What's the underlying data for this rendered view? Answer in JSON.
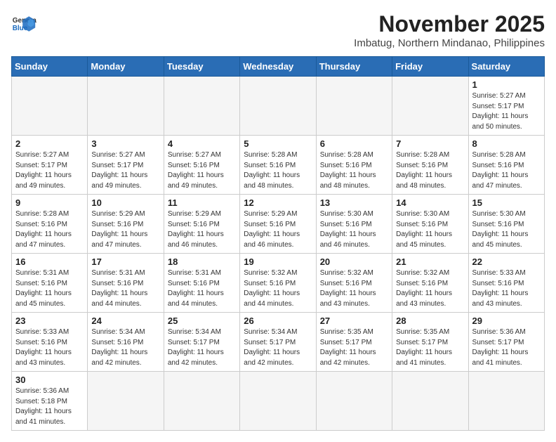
{
  "header": {
    "logo_general": "General",
    "logo_blue": "Blue",
    "month_year": "November 2025",
    "location": "Imbatug, Northern Mindanao, Philippines"
  },
  "days_of_week": [
    "Sunday",
    "Monday",
    "Tuesday",
    "Wednesday",
    "Thursday",
    "Friday",
    "Saturday"
  ],
  "weeks": [
    [
      {
        "day": "",
        "empty": true
      },
      {
        "day": "",
        "empty": true
      },
      {
        "day": "",
        "empty": true
      },
      {
        "day": "",
        "empty": true
      },
      {
        "day": "",
        "empty": true
      },
      {
        "day": "",
        "empty": true
      },
      {
        "day": "1",
        "sunrise": "Sunrise: 5:27 AM",
        "sunset": "Sunset: 5:17 PM",
        "daylight": "Daylight: 11 hours and 50 minutes."
      }
    ],
    [
      {
        "day": "2",
        "sunrise": "Sunrise: 5:27 AM",
        "sunset": "Sunset: 5:17 PM",
        "daylight": "Daylight: 11 hours and 49 minutes."
      },
      {
        "day": "3",
        "sunrise": "Sunrise: 5:27 AM",
        "sunset": "Sunset: 5:17 PM",
        "daylight": "Daylight: 11 hours and 49 minutes."
      },
      {
        "day": "4",
        "sunrise": "Sunrise: 5:27 AM",
        "sunset": "Sunset: 5:16 PM",
        "daylight": "Daylight: 11 hours and 49 minutes."
      },
      {
        "day": "5",
        "sunrise": "Sunrise: 5:28 AM",
        "sunset": "Sunset: 5:16 PM",
        "daylight": "Daylight: 11 hours and 48 minutes."
      },
      {
        "day": "6",
        "sunrise": "Sunrise: 5:28 AM",
        "sunset": "Sunset: 5:16 PM",
        "daylight": "Daylight: 11 hours and 48 minutes."
      },
      {
        "day": "7",
        "sunrise": "Sunrise: 5:28 AM",
        "sunset": "Sunset: 5:16 PM",
        "daylight": "Daylight: 11 hours and 48 minutes."
      },
      {
        "day": "8",
        "sunrise": "Sunrise: 5:28 AM",
        "sunset": "Sunset: 5:16 PM",
        "daylight": "Daylight: 11 hours and 47 minutes."
      }
    ],
    [
      {
        "day": "9",
        "sunrise": "Sunrise: 5:28 AM",
        "sunset": "Sunset: 5:16 PM",
        "daylight": "Daylight: 11 hours and 47 minutes."
      },
      {
        "day": "10",
        "sunrise": "Sunrise: 5:29 AM",
        "sunset": "Sunset: 5:16 PM",
        "daylight": "Daylight: 11 hours and 47 minutes."
      },
      {
        "day": "11",
        "sunrise": "Sunrise: 5:29 AM",
        "sunset": "Sunset: 5:16 PM",
        "daylight": "Daylight: 11 hours and 46 minutes."
      },
      {
        "day": "12",
        "sunrise": "Sunrise: 5:29 AM",
        "sunset": "Sunset: 5:16 PM",
        "daylight": "Daylight: 11 hours and 46 minutes."
      },
      {
        "day": "13",
        "sunrise": "Sunrise: 5:30 AM",
        "sunset": "Sunset: 5:16 PM",
        "daylight": "Daylight: 11 hours and 46 minutes."
      },
      {
        "day": "14",
        "sunrise": "Sunrise: 5:30 AM",
        "sunset": "Sunset: 5:16 PM",
        "daylight": "Daylight: 11 hours and 45 minutes."
      },
      {
        "day": "15",
        "sunrise": "Sunrise: 5:30 AM",
        "sunset": "Sunset: 5:16 PM",
        "daylight": "Daylight: 11 hours and 45 minutes."
      }
    ],
    [
      {
        "day": "16",
        "sunrise": "Sunrise: 5:31 AM",
        "sunset": "Sunset: 5:16 PM",
        "daylight": "Daylight: 11 hours and 45 minutes."
      },
      {
        "day": "17",
        "sunrise": "Sunrise: 5:31 AM",
        "sunset": "Sunset: 5:16 PM",
        "daylight": "Daylight: 11 hours and 44 minutes."
      },
      {
        "day": "18",
        "sunrise": "Sunrise: 5:31 AM",
        "sunset": "Sunset: 5:16 PM",
        "daylight": "Daylight: 11 hours and 44 minutes."
      },
      {
        "day": "19",
        "sunrise": "Sunrise: 5:32 AM",
        "sunset": "Sunset: 5:16 PM",
        "daylight": "Daylight: 11 hours and 44 minutes."
      },
      {
        "day": "20",
        "sunrise": "Sunrise: 5:32 AM",
        "sunset": "Sunset: 5:16 PM",
        "daylight": "Daylight: 11 hours and 43 minutes."
      },
      {
        "day": "21",
        "sunrise": "Sunrise: 5:32 AM",
        "sunset": "Sunset: 5:16 PM",
        "daylight": "Daylight: 11 hours and 43 minutes."
      },
      {
        "day": "22",
        "sunrise": "Sunrise: 5:33 AM",
        "sunset": "Sunset: 5:16 PM",
        "daylight": "Daylight: 11 hours and 43 minutes."
      }
    ],
    [
      {
        "day": "23",
        "sunrise": "Sunrise: 5:33 AM",
        "sunset": "Sunset: 5:16 PM",
        "daylight": "Daylight: 11 hours and 43 minutes."
      },
      {
        "day": "24",
        "sunrise": "Sunrise: 5:34 AM",
        "sunset": "Sunset: 5:16 PM",
        "daylight": "Daylight: 11 hours and 42 minutes."
      },
      {
        "day": "25",
        "sunrise": "Sunrise: 5:34 AM",
        "sunset": "Sunset: 5:17 PM",
        "daylight": "Daylight: 11 hours and 42 minutes."
      },
      {
        "day": "26",
        "sunrise": "Sunrise: 5:34 AM",
        "sunset": "Sunset: 5:17 PM",
        "daylight": "Daylight: 11 hours and 42 minutes."
      },
      {
        "day": "27",
        "sunrise": "Sunrise: 5:35 AM",
        "sunset": "Sunset: 5:17 PM",
        "daylight": "Daylight: 11 hours and 42 minutes."
      },
      {
        "day": "28",
        "sunrise": "Sunrise: 5:35 AM",
        "sunset": "Sunset: 5:17 PM",
        "daylight": "Daylight: 11 hours and 41 minutes."
      },
      {
        "day": "29",
        "sunrise": "Sunrise: 5:36 AM",
        "sunset": "Sunset: 5:17 PM",
        "daylight": "Daylight: 11 hours and 41 minutes."
      }
    ],
    [
      {
        "day": "30",
        "sunrise": "Sunrise: 5:36 AM",
        "sunset": "Sunset: 5:18 PM",
        "daylight": "Daylight: 11 hours and 41 minutes."
      },
      {
        "day": "",
        "empty": true
      },
      {
        "day": "",
        "empty": true
      },
      {
        "day": "",
        "empty": true
      },
      {
        "day": "",
        "empty": true
      },
      {
        "day": "",
        "empty": true
      },
      {
        "day": "",
        "empty": true
      }
    ]
  ]
}
